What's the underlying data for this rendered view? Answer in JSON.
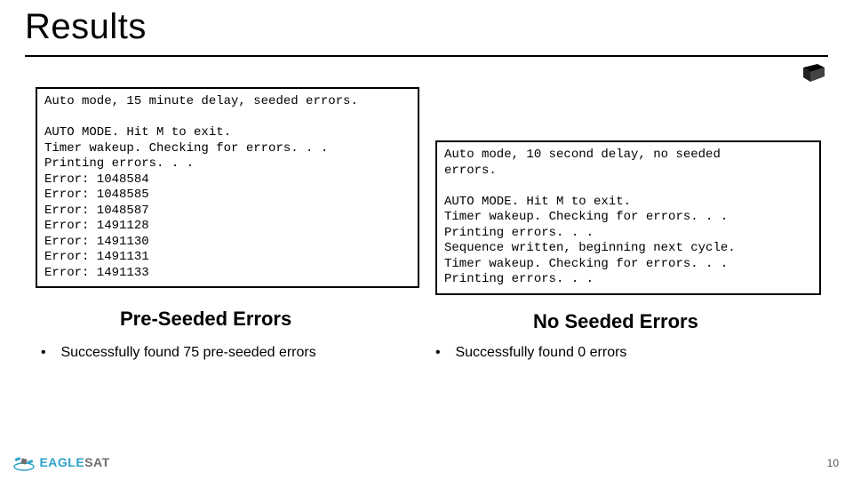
{
  "title": "Results",
  "left_box": {
    "header": "Auto mode, 15 minute delay, seeded errors.",
    "body": "AUTO MODE. Hit M to exit.\nTimer wakeup. Checking for errors. . .\nPrinting errors. . .\nError: 1048584\nError: 1048585\nError: 1048587\nError: 1491128\nError: 1491130\nError: 1491131\nError: 1491133"
  },
  "right_box": {
    "header": "Auto mode, 10 second delay, no seeded\nerrors.",
    "body": "AUTO MODE. Hit M to exit.\nTimer wakeup. Checking for errors. . .\nPrinting errors. . .\nSequence written, beginning next cycle.\nTimer wakeup. Checking for errors. . .\nPrinting errors. . ."
  },
  "subhead_left": "Pre-Seeded Errors",
  "subhead_right": "No Seeded Errors",
  "bullet_left": "Successfully found 75 pre-seeded errors",
  "bullet_right": "Successfully found 0 errors",
  "page_number": "10",
  "logo_text_a": "EAGLE",
  "logo_text_b": "SAT"
}
